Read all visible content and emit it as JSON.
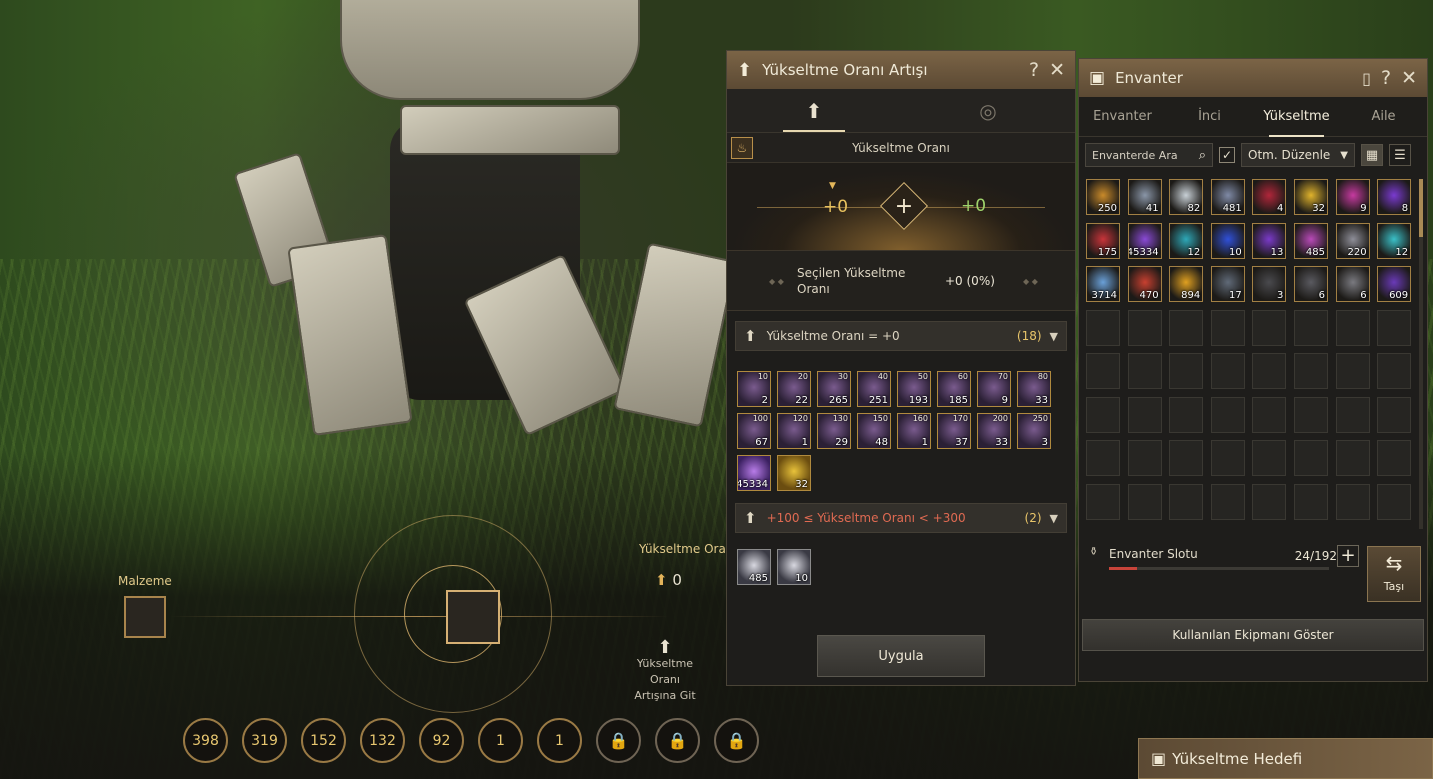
{
  "hud": {
    "material_label": "Malzeme",
    "upgrade_rate_label": "Yükseltme Oranı Artışı",
    "upgrade_rate_value": "0",
    "go_to_label_1": "Yükseltme",
    "go_to_label_2": "Oranı",
    "go_to_label_3": "Artışına Git",
    "counts": [
      "398",
      "319",
      "152",
      "132",
      "92",
      "1",
      "1"
    ],
    "locked_count": 3
  },
  "upgrade_panel": {
    "title": "Yükseltme Oranı Artışı",
    "help": "?",
    "close": "✕",
    "rate_section_title": "Yükseltme Oranı",
    "rate_left": "+0",
    "rate_right": "+0",
    "selected_label": "Seçilen Yükseltme Oranı",
    "selected_value": "+0 (0%)",
    "group1": {
      "label": "Yükseltme Oranı = +0",
      "count": "(18)"
    },
    "group1_items": [
      {
        "lv": "10",
        "q": "2"
      },
      {
        "lv": "20",
        "q": "22"
      },
      {
        "lv": "30",
        "q": "265"
      },
      {
        "lv": "40",
        "q": "251"
      },
      {
        "lv": "50",
        "q": "193"
      },
      {
        "lv": "60",
        "q": "185"
      },
      {
        "lv": "70",
        "q": "9"
      },
      {
        "lv": "80",
        "q": "33"
      },
      {
        "lv": "100",
        "q": "67"
      },
      {
        "lv": "120",
        "q": "1"
      },
      {
        "lv": "130",
        "q": "29"
      },
      {
        "lv": "150",
        "q": "48"
      },
      {
        "lv": "160",
        "q": "1"
      },
      {
        "lv": "170",
        "q": "37"
      },
      {
        "lv": "200",
        "q": "33"
      },
      {
        "lv": "250",
        "q": "3"
      }
    ],
    "group1_extra": [
      {
        "q": "45334",
        "kind": "purple2"
      },
      {
        "q": "32",
        "kind": "gold"
      }
    ],
    "group2": {
      "label": "+100 ≤ Yükseltme Oranı < +300",
      "count": "(2)"
    },
    "group2_items": [
      {
        "q": "485"
      },
      {
        "q": "10"
      }
    ],
    "apply": "Uygula"
  },
  "inventory": {
    "title": "Envanter",
    "tabs": [
      "Envanter",
      "İnci",
      "Yükseltme",
      "Aile"
    ],
    "active_tab": 2,
    "search_placeholder": "Envanterde Ara",
    "sort_label": "Otm. Düzenle",
    "items": [
      {
        "q": "250",
        "c": "#c98a2a"
      },
      {
        "q": "41",
        "c": "#8a96a8"
      },
      {
        "q": "82",
        "c": "#c8d0d6"
      },
      {
        "q": "481",
        "c": "#7f8aa6"
      },
      {
        "q": "4",
        "c": "#b0263a"
      },
      {
        "q": "32",
        "c": "#e0b32c"
      },
      {
        "q": "9",
        "c": "#c63aa0"
      },
      {
        "q": "8",
        "c": "#7a3ad0"
      },
      {
        "q": "175",
        "c": "#c8343a"
      },
      {
        "q": "45334",
        "c": "#8a4ad6"
      },
      {
        "q": "12",
        "c": "#2ea8b8"
      },
      {
        "q": "10",
        "c": "#3050d8"
      },
      {
        "q": "13",
        "c": "#7a3ac8"
      },
      {
        "q": "485",
        "c": "#b84ab8"
      },
      {
        "q": "220",
        "c": "#8e8e98"
      },
      {
        "q": "12",
        "c": "#3ac0c8"
      },
      {
        "q": "3714",
        "c": "#6aa0d8"
      },
      {
        "q": "470",
        "c": "#c84030"
      },
      {
        "q": "894",
        "c": "#e0a020"
      },
      {
        "q": "17",
        "c": "#606a78"
      },
      {
        "q": "3",
        "c": "#4a4a4e"
      },
      {
        "q": "6",
        "c": "#5a5a60"
      },
      {
        "q": "6",
        "c": "#7a7a80"
      },
      {
        "q": "609",
        "c": "#6a3ab8"
      }
    ],
    "empty_slots": 40,
    "slot_label": "Envanter Slotu",
    "slot_count": "24/192",
    "slot_fraction": 0.125,
    "move_label": "Taşı",
    "equip_button": "Kullanılan Ekipmanı Göster"
  },
  "goal": {
    "label": "Yükseltme Hedefi"
  }
}
